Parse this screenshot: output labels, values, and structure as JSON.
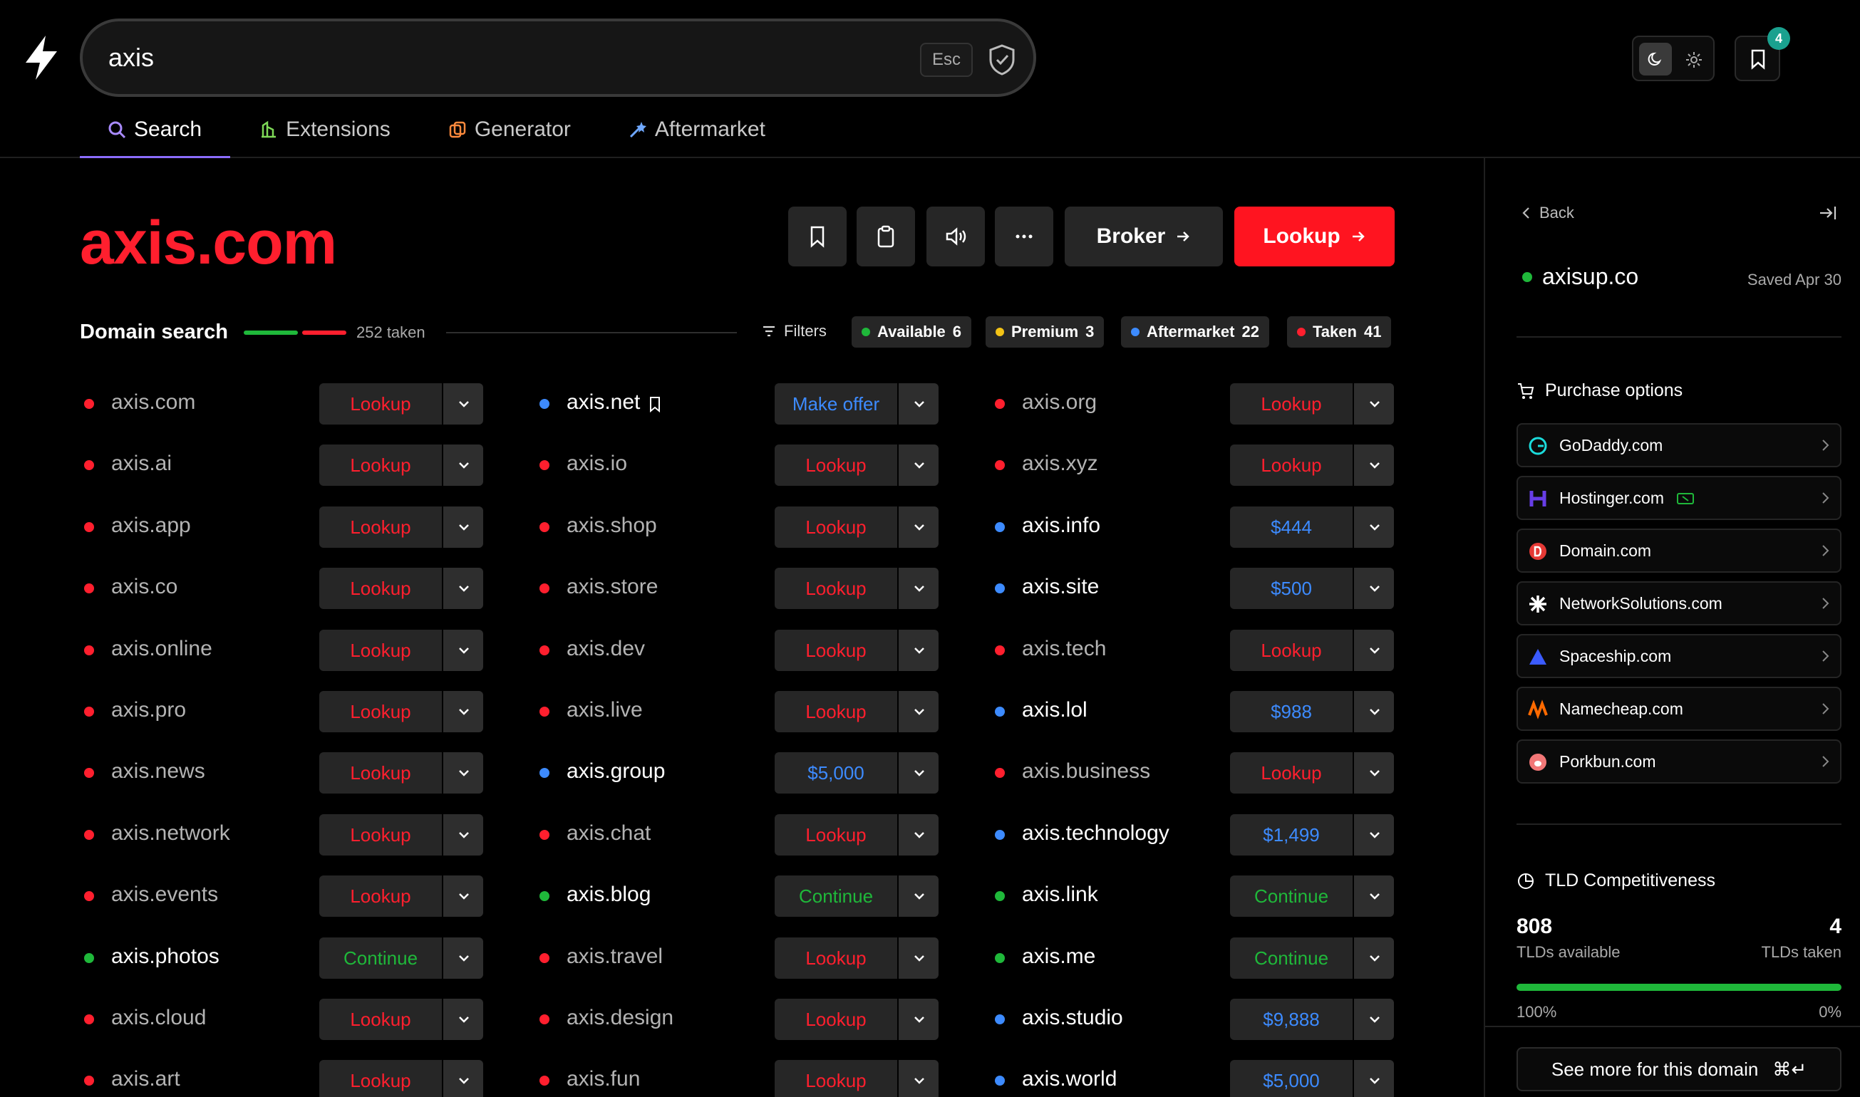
{
  "search": {
    "query": "axis",
    "esc_label": "Esc"
  },
  "tabs": [
    {
      "label": "Search",
      "icon": "search-icon"
    },
    {
      "label": "Extensions",
      "icon": "extensions-icon"
    },
    {
      "label": "Generator",
      "icon": "generator-icon"
    },
    {
      "label": "Aftermarket",
      "icon": "aftermarket-icon"
    }
  ],
  "header": {
    "saved_count": "4"
  },
  "domain": {
    "title": "axis.com",
    "broker_label": "Broker",
    "lookup_label": "Lookup"
  },
  "domain_search": {
    "label": "Domain search",
    "taken_count": "252 taken",
    "filters_label": "Filters",
    "chips": [
      {
        "label": "Available",
        "count": "6",
        "color": "#1fb83a"
      },
      {
        "label": "Premium",
        "count": "3",
        "color": "#f3c316"
      },
      {
        "label": "Aftermarket",
        "count": "22",
        "color": "#3d8bff"
      },
      {
        "label": "Taken",
        "count": "41",
        "color": "#ff1f2e"
      }
    ]
  },
  "colors": {
    "taken": "#ff1f2e",
    "available": "#1fb83a",
    "aftermarket": "#3d8bff",
    "muted_text": "#b3b3b3"
  },
  "columns": [
    [
      {
        "name": "axis.com",
        "action": "Lookup",
        "status": "taken"
      },
      {
        "name": "axis.ai",
        "action": "Lookup",
        "status": "taken"
      },
      {
        "name": "axis.app",
        "action": "Lookup",
        "status": "taken"
      },
      {
        "name": "axis.co",
        "action": "Lookup",
        "status": "taken"
      },
      {
        "name": "axis.online",
        "action": "Lookup",
        "status": "taken"
      },
      {
        "name": "axis.pro",
        "action": "Lookup",
        "status": "taken"
      },
      {
        "name": "axis.news",
        "action": "Lookup",
        "status": "taken"
      },
      {
        "name": "axis.network",
        "action": "Lookup",
        "status": "taken"
      },
      {
        "name": "axis.events",
        "action": "Lookup",
        "status": "taken"
      },
      {
        "name": "axis.photos",
        "action": "Continue",
        "status": "available"
      },
      {
        "name": "axis.cloud",
        "action": "Lookup",
        "status": "taken"
      },
      {
        "name": "axis.art",
        "action": "Lookup",
        "status": "taken"
      }
    ],
    [
      {
        "name": "axis.net",
        "action": "Make offer",
        "status": "aftermarket",
        "bookmarked": true
      },
      {
        "name": "axis.io",
        "action": "Lookup",
        "status": "taken"
      },
      {
        "name": "axis.shop",
        "action": "Lookup",
        "status": "taken"
      },
      {
        "name": "axis.store",
        "action": "Lookup",
        "status": "taken"
      },
      {
        "name": "axis.dev",
        "action": "Lookup",
        "status": "taken"
      },
      {
        "name": "axis.live",
        "action": "Lookup",
        "status": "taken"
      },
      {
        "name": "axis.group",
        "action": "$5,000",
        "status": "aftermarket"
      },
      {
        "name": "axis.chat",
        "action": "Lookup",
        "status": "taken"
      },
      {
        "name": "axis.blog",
        "action": "Continue",
        "status": "available"
      },
      {
        "name": "axis.travel",
        "action": "Lookup",
        "status": "taken"
      },
      {
        "name": "axis.design",
        "action": "Lookup",
        "status": "taken"
      },
      {
        "name": "axis.fun",
        "action": "Lookup",
        "status": "taken"
      }
    ],
    [
      {
        "name": "axis.org",
        "action": "Lookup",
        "status": "taken"
      },
      {
        "name": "axis.xyz",
        "action": "Lookup",
        "status": "taken"
      },
      {
        "name": "axis.info",
        "action": "$444",
        "status": "aftermarket"
      },
      {
        "name": "axis.site",
        "action": "$500",
        "status": "aftermarket"
      },
      {
        "name": "axis.tech",
        "action": "Lookup",
        "status": "taken"
      },
      {
        "name": "axis.lol",
        "action": "$988",
        "status": "aftermarket"
      },
      {
        "name": "axis.business",
        "action": "Lookup",
        "status": "taken"
      },
      {
        "name": "axis.technology",
        "action": "$1,499",
        "status": "aftermarket"
      },
      {
        "name": "axis.link",
        "action": "Continue",
        "status": "available"
      },
      {
        "name": "axis.me",
        "action": "Continue",
        "status": "available"
      },
      {
        "name": "axis.studio",
        "action": "$9,888",
        "status": "aftermarket"
      },
      {
        "name": "axis.world",
        "action": "$5,000",
        "status": "aftermarket"
      }
    ]
  ],
  "sidebar": {
    "back_label": "Back",
    "saved_domain": "axisup.co",
    "saved_date": "Saved Apr 30",
    "purchase_title": "Purchase options",
    "registrars": [
      {
        "name": "GoDaddy.com",
        "icon": "godaddy-icon",
        "color": "#1bdbdb"
      },
      {
        "name": "Hostinger.com",
        "icon": "hostinger-icon",
        "color": "#673de6"
      },
      {
        "name": "Domain.com",
        "icon": "domaincom-icon",
        "color": "#e53935"
      },
      {
        "name": "NetworkSolutions.com",
        "icon": "networksolutions-icon",
        "color": "#ffffff"
      },
      {
        "name": "Spaceship.com",
        "icon": "spaceship-icon",
        "color": "#3b5bff"
      },
      {
        "name": "Namecheap.com",
        "icon": "namecheap-icon",
        "color": "#ff6a00"
      },
      {
        "name": "Porkbun.com",
        "icon": "porkbun-icon",
        "color": "#f27777"
      }
    ],
    "tld_title": "TLD Competitiveness",
    "tlds_available": "808",
    "tlds_available_label": "TLDs available",
    "tlds_taken": "4",
    "tlds_taken_label": "TLDs taken",
    "pct_available": "100%",
    "pct_taken": "0%",
    "available_fraction": 1.0,
    "see_more_label": "See more for this domain",
    "see_more_shortcut": "⌘↵"
  }
}
